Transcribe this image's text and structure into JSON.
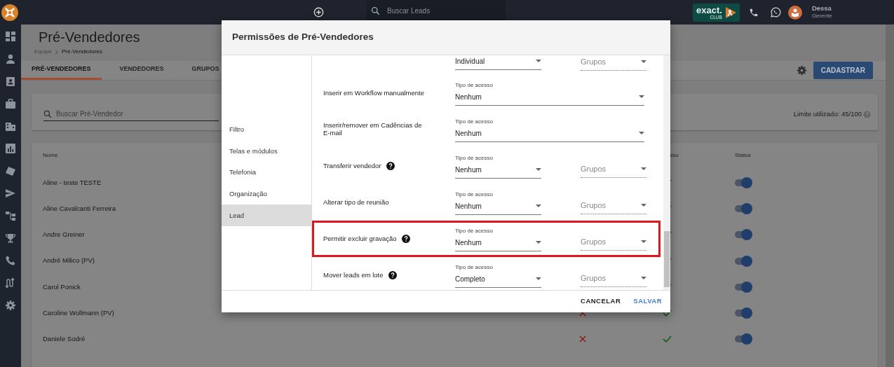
{
  "topbar": {
    "search_placeholder": "Buscar Leads",
    "brand": {
      "name": "exact.",
      "sub": "CLUB"
    },
    "user": {
      "name": "Dessa",
      "role": "Gerente"
    }
  },
  "page": {
    "title": "Pré-Vendedores",
    "breadcrumb": [
      "Equipe",
      "Pré-Vendedores"
    ],
    "tabs": [
      {
        "label": "PRÉ-VENDEDORES",
        "selected": true
      },
      {
        "label": "VENDEDORES",
        "selected": false
      },
      {
        "label": "GRUPOS",
        "selected": false
      }
    ],
    "register_button": "CADASTRAR",
    "search_placeholder": "Buscar Pré-Vendedor",
    "limit": "Limite utilizado: 45/100",
    "table": {
      "columns": [
        "Nome",
        "sso",
        "Status"
      ],
      "rows": [
        {
          "name": "Aline - teste TESTE",
          "column_3": true,
          "active": true
        },
        {
          "name": "Aline Cavalcanti Ferreira",
          "column_3": true,
          "active": true
        },
        {
          "name": "Andre Greiner",
          "column_3": true,
          "active": true
        },
        {
          "name": "André Milico (PV)",
          "column_3": true,
          "active": true
        },
        {
          "name": "Carol Ponick",
          "column_3": true,
          "active": true
        },
        {
          "name": "Caroline Wollmann (PV)",
          "column_2": false,
          "column_3": true,
          "active": true
        },
        {
          "name": "Daniele Sodré",
          "column_2": false,
          "column_3": true,
          "active": true
        }
      ]
    }
  },
  "modal": {
    "title": "Permissões de Pré-Vendedores",
    "nav": [
      {
        "label": "Filtro",
        "selected": false
      },
      {
        "label": "Telas e módulos",
        "selected": false
      },
      {
        "label": "Telefonia",
        "selected": false
      },
      {
        "label": "Organização",
        "selected": false
      },
      {
        "label": "Lead",
        "selected": true
      }
    ],
    "rows": [
      {
        "kind": "partial",
        "access_value": "Individual",
        "groups_placeholder": "Grupos"
      },
      {
        "kind": "single",
        "label": "Inserir em Workflow manualmente",
        "help": false,
        "access_label": "Tipo de acesso",
        "access_value": "Nenhum",
        "highlighted": false
      },
      {
        "kind": "single",
        "label": "Inserir/remover em Cadências de E-mail",
        "help": false,
        "access_label": "Tipo de acesso",
        "access_value": "Nenhum",
        "highlighted": false
      },
      {
        "kind": "groups",
        "label": "Transferir vendedor",
        "help": true,
        "access_label": "Tipo de acesso",
        "access_value": "Nenhum",
        "groups_placeholder": "Grupos",
        "highlighted": false
      },
      {
        "kind": "groups",
        "label": "Alterar tipo de reunião",
        "help": false,
        "access_label": "Tipo de acesso",
        "access_value": "Nenhum",
        "groups_placeholder": "Grupos",
        "highlighted": false
      },
      {
        "kind": "groups",
        "label": "Permitir excluir gravação",
        "help": true,
        "access_label": "Tipo de acesso",
        "access_value": "Nenhum",
        "groups_placeholder": "Grupos",
        "highlighted": true
      },
      {
        "kind": "groups",
        "label": "Mover leads em lote",
        "help": true,
        "access_label": "Tipo de acesso",
        "access_value": "Completo",
        "groups_placeholder": "Grupos",
        "highlighted": false
      }
    ],
    "buttons": [
      {
        "label": "CANCELAR",
        "kind": "secondary"
      },
      {
        "label": "SALVAR",
        "kind": "primary"
      }
    ]
  }
}
